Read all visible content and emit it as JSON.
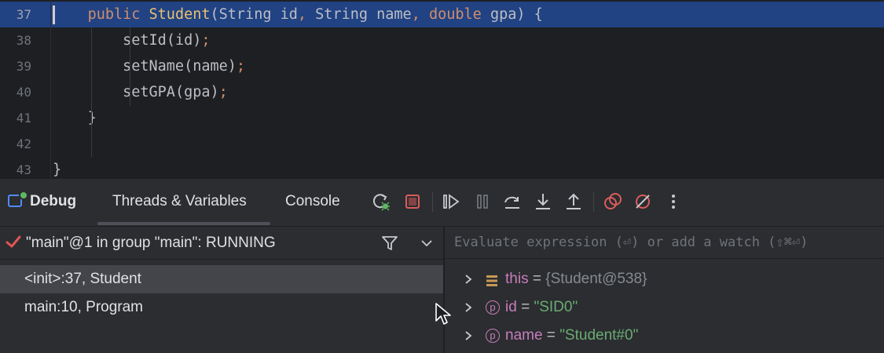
{
  "editor": {
    "lines": [
      {
        "num": "37",
        "indent": "    ",
        "tokens": [
          {
            "t": "public ",
            "c": "kw"
          },
          {
            "t": "Student",
            "c": "ctor"
          },
          {
            "t": "(",
            "c": ""
          },
          {
            "t": "String",
            "c": ""
          },
          {
            "t": " id",
            "c": ""
          },
          {
            "t": ", ",
            "c": "punct"
          },
          {
            "t": "String",
            "c": ""
          },
          {
            "t": " name",
            "c": ""
          },
          {
            "t": ", ",
            "c": "punct"
          },
          {
            "t": "double",
            "c": "kw"
          },
          {
            "t": " gpa",
            "c": ""
          },
          {
            "t": ") {",
            "c": ""
          }
        ]
      },
      {
        "num": "38",
        "indent": "        ",
        "tokens": [
          {
            "t": "setId",
            "c": ""
          },
          {
            "t": "(id)",
            "c": ""
          },
          {
            "t": ";",
            "c": "punct"
          }
        ]
      },
      {
        "num": "39",
        "indent": "        ",
        "tokens": [
          {
            "t": "setName",
            "c": ""
          },
          {
            "t": "(name)",
            "c": ""
          },
          {
            "t": ";",
            "c": "punct"
          }
        ]
      },
      {
        "num": "40",
        "indent": "        ",
        "tokens": [
          {
            "t": "setGPA",
            "c": ""
          },
          {
            "t": "(gpa)",
            "c": ""
          },
          {
            "t": ";",
            "c": "punct"
          }
        ]
      },
      {
        "num": "41",
        "indent": "    ",
        "tokens": [
          {
            "t": "}",
            "c": ""
          }
        ]
      },
      {
        "num": "42",
        "indent": "",
        "tokens": []
      },
      {
        "num": "43",
        "indent": "",
        "tokens": [
          {
            "t": "}",
            "c": ""
          }
        ]
      }
    ]
  },
  "debug_toolbar": {
    "title": "Debug",
    "tabs": [
      "Threads & Variables",
      "Console"
    ],
    "active_tab": "Threads & Variables",
    "buttons": [
      {
        "name": "rerun-icon",
        "color": "#c7c9cf"
      },
      {
        "name": "stop-icon",
        "color": "#db5c5c"
      },
      {
        "name": "resume-icon",
        "color": "#c7c9cf"
      },
      {
        "name": "pause-icon",
        "color": "#6f737a"
      },
      {
        "name": "step-over-icon",
        "color": "#c7c9cf"
      },
      {
        "name": "step-into-icon",
        "color": "#c7c9cf"
      },
      {
        "name": "step-out-icon",
        "color": "#c7c9cf"
      },
      {
        "name": "view-breakpoints-icon",
        "color": "#db5c5c"
      },
      {
        "name": "mute-breakpoints-icon",
        "color": "#db5c5c"
      },
      {
        "name": "more-options-icon",
        "color": "#c7c9cf"
      }
    ]
  },
  "frames": {
    "thread": "\"main\"@1 in group \"main\": RUNNING",
    "items": [
      {
        "label": "<init>:37, Student",
        "selected": true
      },
      {
        "label": "main:10, Program",
        "selected": false
      }
    ]
  },
  "variables": {
    "eval_placeholder": "Evaluate expression (⏎) or add a watch (⇧⌘⏎)",
    "items": [
      {
        "icon": "field-list-icon",
        "name": "this",
        "eq": " = ",
        "value": "{Student@538}",
        "kind": "obj"
      },
      {
        "icon": "parameter-icon",
        "badge": "p",
        "name": "id",
        "eq": " = ",
        "value": "\"SID0\"",
        "kind": "str"
      },
      {
        "icon": "parameter-icon",
        "badge": "p",
        "name": "name",
        "eq": " = ",
        "value": "\"Student#0\"",
        "kind": "str"
      }
    ]
  },
  "colors": {
    "current_line": "#214283",
    "panel_bg": "#2b2d30",
    "editor_bg": "#1e1f22",
    "string": "#6aab73",
    "keyword": "#cf8e6d"
  }
}
